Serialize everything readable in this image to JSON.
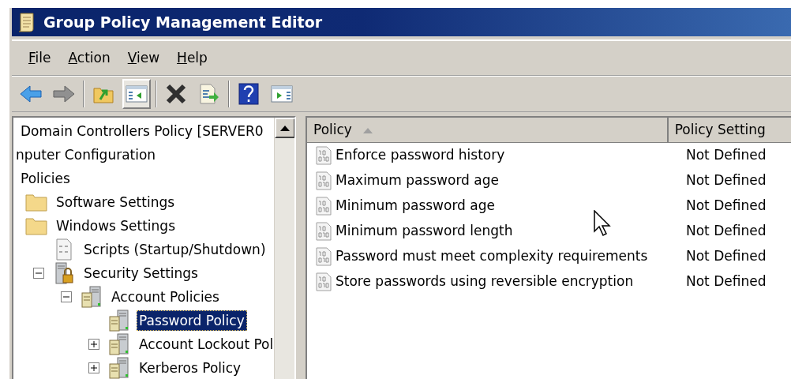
{
  "window": {
    "title": "Group Policy Management Editor"
  },
  "menu": [
    {
      "label": "File"
    },
    {
      "label": "Action"
    },
    {
      "label": "View"
    },
    {
      "label": "Help"
    }
  ],
  "toolbar": [
    {
      "kind": "back",
      "pressed": false
    },
    {
      "kind": "forward",
      "pressed": false
    },
    {
      "kind": "separator"
    },
    {
      "kind": "up",
      "pressed": false
    },
    {
      "kind": "tree-toggle",
      "pressed": true
    },
    {
      "kind": "separator"
    },
    {
      "kind": "delete",
      "pressed": false
    },
    {
      "kind": "export",
      "pressed": false
    },
    {
      "kind": "separator"
    },
    {
      "kind": "help",
      "pressed": false
    },
    {
      "kind": "action-pane",
      "pressed": false
    }
  ],
  "tree": [
    {
      "label": "Domain Controllers Policy [SERVER0",
      "selected": false,
      "children": [
        {
          "label": "nputer Configuration",
          "selected": false,
          "children": [
            {
              "label": "Policies",
              "selected": false,
              "children": [
                {
                  "label": "Software Settings",
                  "kind": "folder",
                  "selected": false
                },
                {
                  "label": "Windows Settings",
                  "kind": "folder",
                  "selected": false,
                  "children": [
                    {
                      "label": "Scripts (Startup/Shutdown)",
                      "kind": "script",
                      "selected": false
                    },
                    {
                      "label": "Security Settings",
                      "kind": "security",
                      "selected": false,
                      "expanded": true,
                      "children": [
                        {
                          "label": "Account Policies",
                          "kind": "policy",
                          "selected": false,
                          "expanded": true,
                          "children": [
                            {
                              "label": "Password Policy",
                              "kind": "policy",
                              "selected": true
                            },
                            {
                              "label": "Account Lockout Pol",
                              "kind": "policy",
                              "selected": false,
                              "expanded": false
                            },
                            {
                              "label": "Kerberos Policy",
                              "kind": "policy",
                              "selected": false,
                              "expanded": false
                            }
                          ]
                        }
                      ]
                    }
                  ]
                }
              ]
            }
          ]
        }
      ]
    }
  ],
  "table": {
    "columns": [
      {
        "label": "Policy",
        "sorted_ascending": true
      },
      {
        "label": "Policy Setting"
      }
    ],
    "rows": [
      {
        "policy": "Enforce password history",
        "setting": "Not Defined"
      },
      {
        "policy": "Maximum password age",
        "setting": "Not Defined"
      },
      {
        "policy": "Minimum password age",
        "setting": "Not Defined"
      },
      {
        "policy": "Minimum password length",
        "setting": "Not Defined"
      },
      {
        "policy": "Password must meet complexity requirements",
        "setting": "Not Defined"
      },
      {
        "policy": "Store passwords using reversible encryption",
        "setting": "Not Defined"
      }
    ]
  }
}
